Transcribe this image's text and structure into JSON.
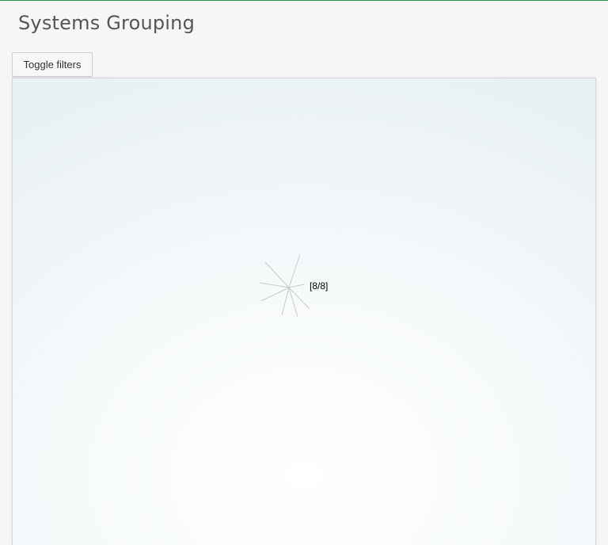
{
  "page": {
    "title": "Systems Grouping"
  },
  "toolbar": {
    "toggle_filters_label": "Toggle filters"
  },
  "graph": {
    "cluster_label": "[8/8]"
  },
  "colors": {
    "accent": "#2a8a4a",
    "edge": "#c8c8c8"
  }
}
